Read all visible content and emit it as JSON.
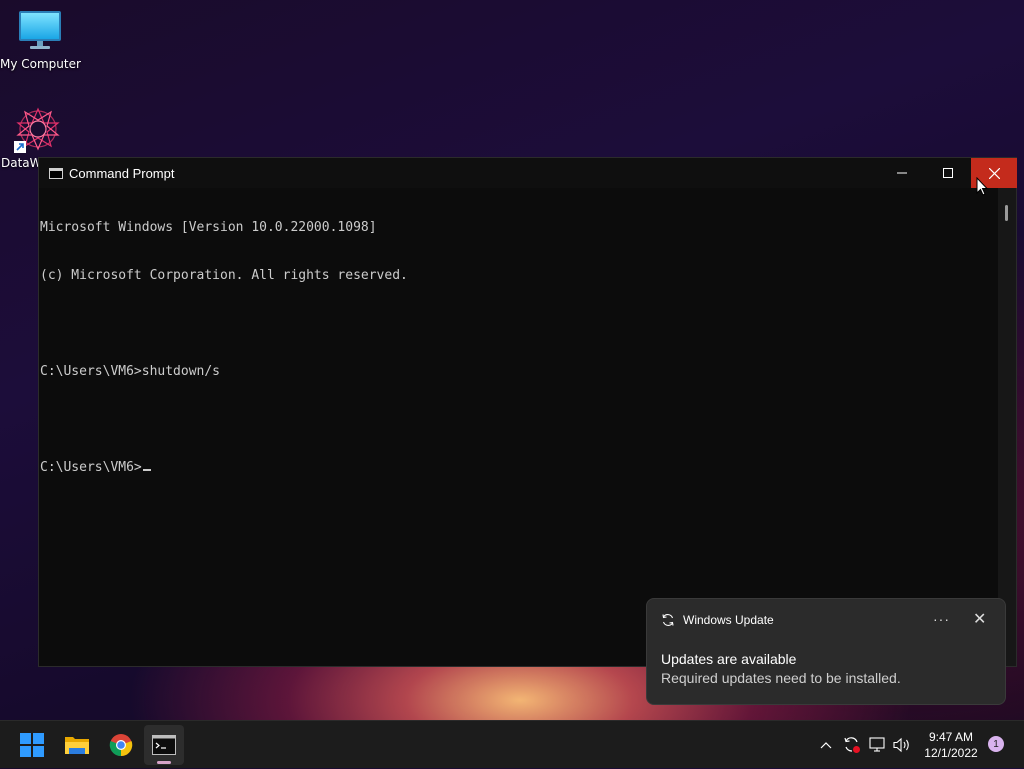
{
  "desktop": {
    "icons": [
      {
        "label": "My Computer"
      },
      {
        "label": "DataW"
      }
    ]
  },
  "window": {
    "title": "Command Prompt",
    "controls": {
      "minimize": "─",
      "maximize": "☐",
      "close": "✕"
    },
    "console_lines": [
      "Microsoft Windows [Version 10.0.22000.1098]",
      "(c) Microsoft Corporation. All rights reserved.",
      "",
      "C:\\Users\\VM6>shutdown/s",
      "",
      "C:\\Users\\VM6>"
    ]
  },
  "toast": {
    "app_name": "Windows Update",
    "more_label": "···",
    "close_label": "✕",
    "title": "Updates are available",
    "body": "Required updates need to be installed."
  },
  "taskbar": {
    "apps": [
      "start-icon",
      "file-explorer-icon",
      "chrome-icon",
      "command-prompt-icon"
    ],
    "tray_chevron": "^",
    "time": "9:47 AM",
    "date": "12/1/2022",
    "notification_count": "1"
  },
  "colors": {
    "close_button": "#c42b1c",
    "console_bg": "#0c0c0c",
    "console_text": "#cccccc"
  }
}
